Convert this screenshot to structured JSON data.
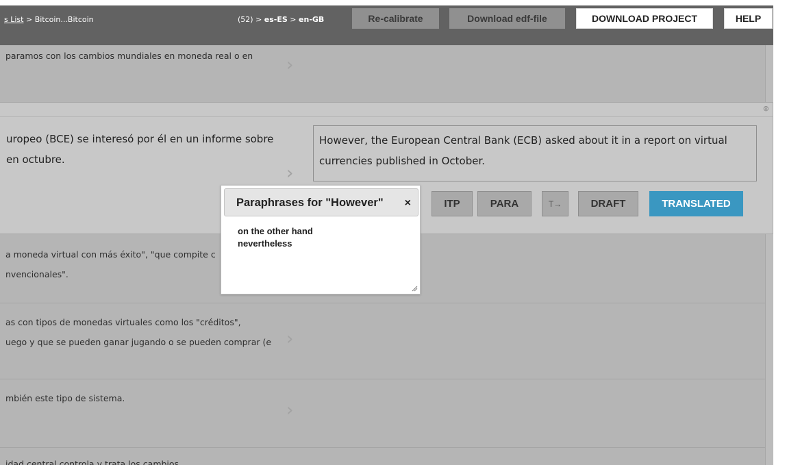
{
  "header": {
    "breadcrumb_link": "s List",
    "breadcrumb_sep": " > ",
    "breadcrumb_project": "Bitcoin...Bitcoin",
    "segment_count": "(52) > ",
    "source_lang": "es-ES",
    "lang_sep": " > ",
    "target_lang": "en-GB",
    "recalibrate_label": "Re-calibrate",
    "download_edf_label": "Download edf-file",
    "download_project_label": "DOWNLOAD PROJECT",
    "help_label": "HELP"
  },
  "segments_above": [
    {
      "source_line1": "paramos con los cambios mundiales en moneda real o en"
    }
  ],
  "active_segment": {
    "source_line1": "uropeo (BCE) se interesó por él en un informe sobre",
    "source_line2": " en octubre.",
    "target_text": "However, the European Central Bank (ECB) asked about it in a report on virtual currencies published in October.",
    "buttons": {
      "itp": "ITP",
      "para": "PARA",
      "text_tool": "T→",
      "draft": "DRAFT",
      "translated": "TRANSLATED"
    }
  },
  "segments_below": [
    {
      "source_line1": "a moneda virtual con más éxito\", \"que compite c",
      "source_line2": "nvencionales\"."
    },
    {
      "source_line1": "as con tipos de monedas virtuales como los \"créditos\",",
      "source_line2": "uego y que se pueden ganar jugando o se pueden comprar (e"
    },
    {
      "source_line1": "mbién este tipo de sistema."
    },
    {
      "source_line1": "idad central controla y trata los cambios"
    }
  ],
  "paraphrase_popup": {
    "title": "Paraphrases for \"However\"",
    "close_label": "×",
    "items": [
      "on the other hand",
      "nevertheless"
    ]
  },
  "icons": {
    "chevron": "›",
    "close_segment": "⊗"
  },
  "colors": {
    "header_bg": "#626262",
    "translated_button": "#3a97c1",
    "overlay_bg": "#b5b5b5"
  }
}
